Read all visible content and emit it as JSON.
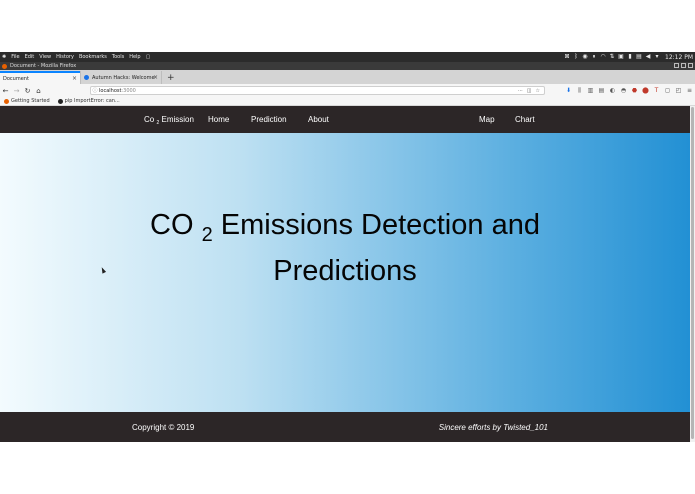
{
  "system": {
    "menu": [
      "File",
      "Edit",
      "View",
      "History",
      "Bookmarks",
      "Tools",
      "Help"
    ],
    "time": "12:12 PM"
  },
  "window": {
    "title": "Document - Mozilla Firefox"
  },
  "tabs": [
    {
      "label": "Document",
      "active": true
    },
    {
      "label": "Autumn Hacks: Welcome",
      "active": false
    }
  ],
  "toolbar": {
    "url_host": "localhost",
    "url_port": ":3000"
  },
  "bookmarks": [
    {
      "label": "Getting Started"
    },
    {
      "label": "pip ImportError: can..."
    }
  ],
  "site": {
    "nav": {
      "brand_prefix": "Co",
      "brand_sub": "2",
      "brand_suffix": "Emission",
      "home": "Home",
      "prediction": "Prediction",
      "about": "About",
      "map": "Map",
      "chart": "Chart"
    },
    "hero": {
      "line1_prefix": "CO",
      "line1_sub": "2",
      "line1_suffix": "Emissions Detection and",
      "line2": "Predictions"
    },
    "footer": {
      "copyright": "Copyright © 2019",
      "credit": "Sincere efforts by Twisted_101"
    }
  },
  "colors": {
    "nav_bg": "#2c2627",
    "hero_start": "#f3fbfe",
    "hero_end": "#2290d4",
    "footer_bg": "#2c2627"
  }
}
